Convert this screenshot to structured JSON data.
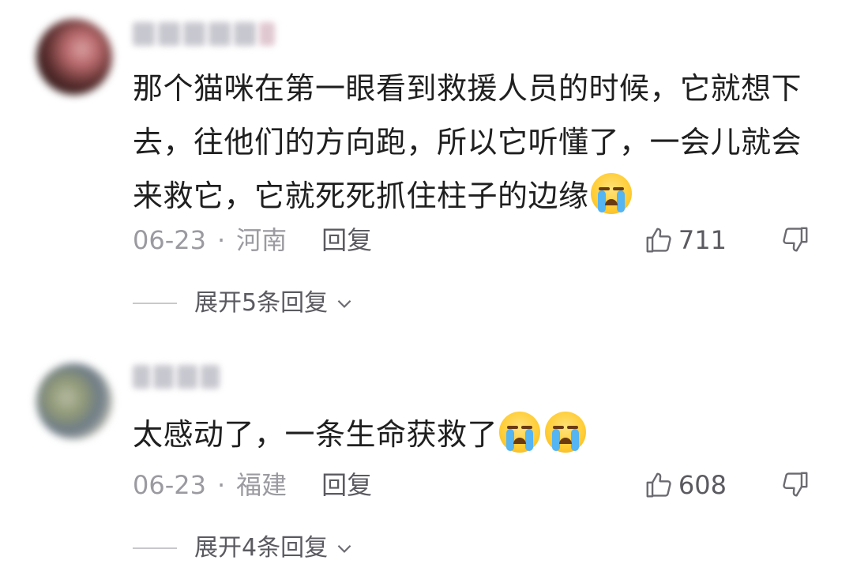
{
  "comments": [
    {
      "content": "那个猫咪在第一眼看到救援人员的时候，它就想下去，往他们的方向跑，所以它听懂了，一会儿就会来救它，它就死死抓住柱子的边缘",
      "emoji_count": 1,
      "date": "06-23",
      "separator": "·",
      "location": "河南",
      "reply_label": "回复",
      "likes": "711",
      "expand_label": "展开5条回复"
    },
    {
      "content": "太感动了，一条生命获救了",
      "emoji_count": 2,
      "date": "06-23",
      "separator": "·",
      "location": "福建",
      "reply_label": "回复",
      "likes": "608",
      "expand_label": "展开4条回复"
    }
  ],
  "icons": {
    "like": "thumbs-up-icon",
    "dislike": "thumbs-down-icon",
    "expand": "chevron-down-icon",
    "emoji": "crying-face-emoji"
  }
}
